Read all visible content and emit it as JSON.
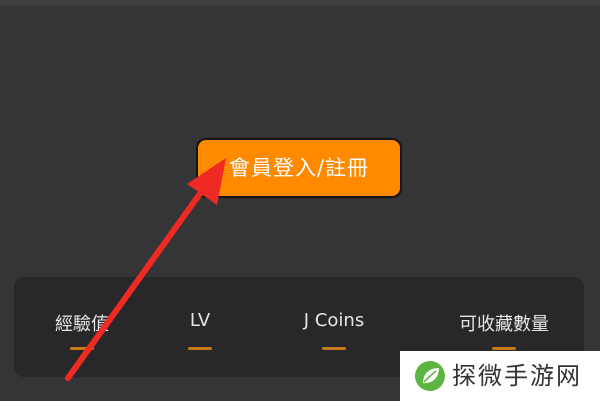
{
  "login": {
    "button_label": "會員登入/註冊"
  },
  "stats": [
    {
      "label": "經驗值"
    },
    {
      "label": "LV"
    },
    {
      "label": "J Coins"
    },
    {
      "label": "可收藏數量"
    }
  ],
  "watermark": {
    "text": "探微手游网"
  },
  "colors": {
    "background": "#353537",
    "accent_orange": "#ff8a00",
    "panel": "#28282a",
    "arrow_red": "#ee2a22",
    "underline": "#c77a1a",
    "watermark_green": "#5bb543"
  }
}
